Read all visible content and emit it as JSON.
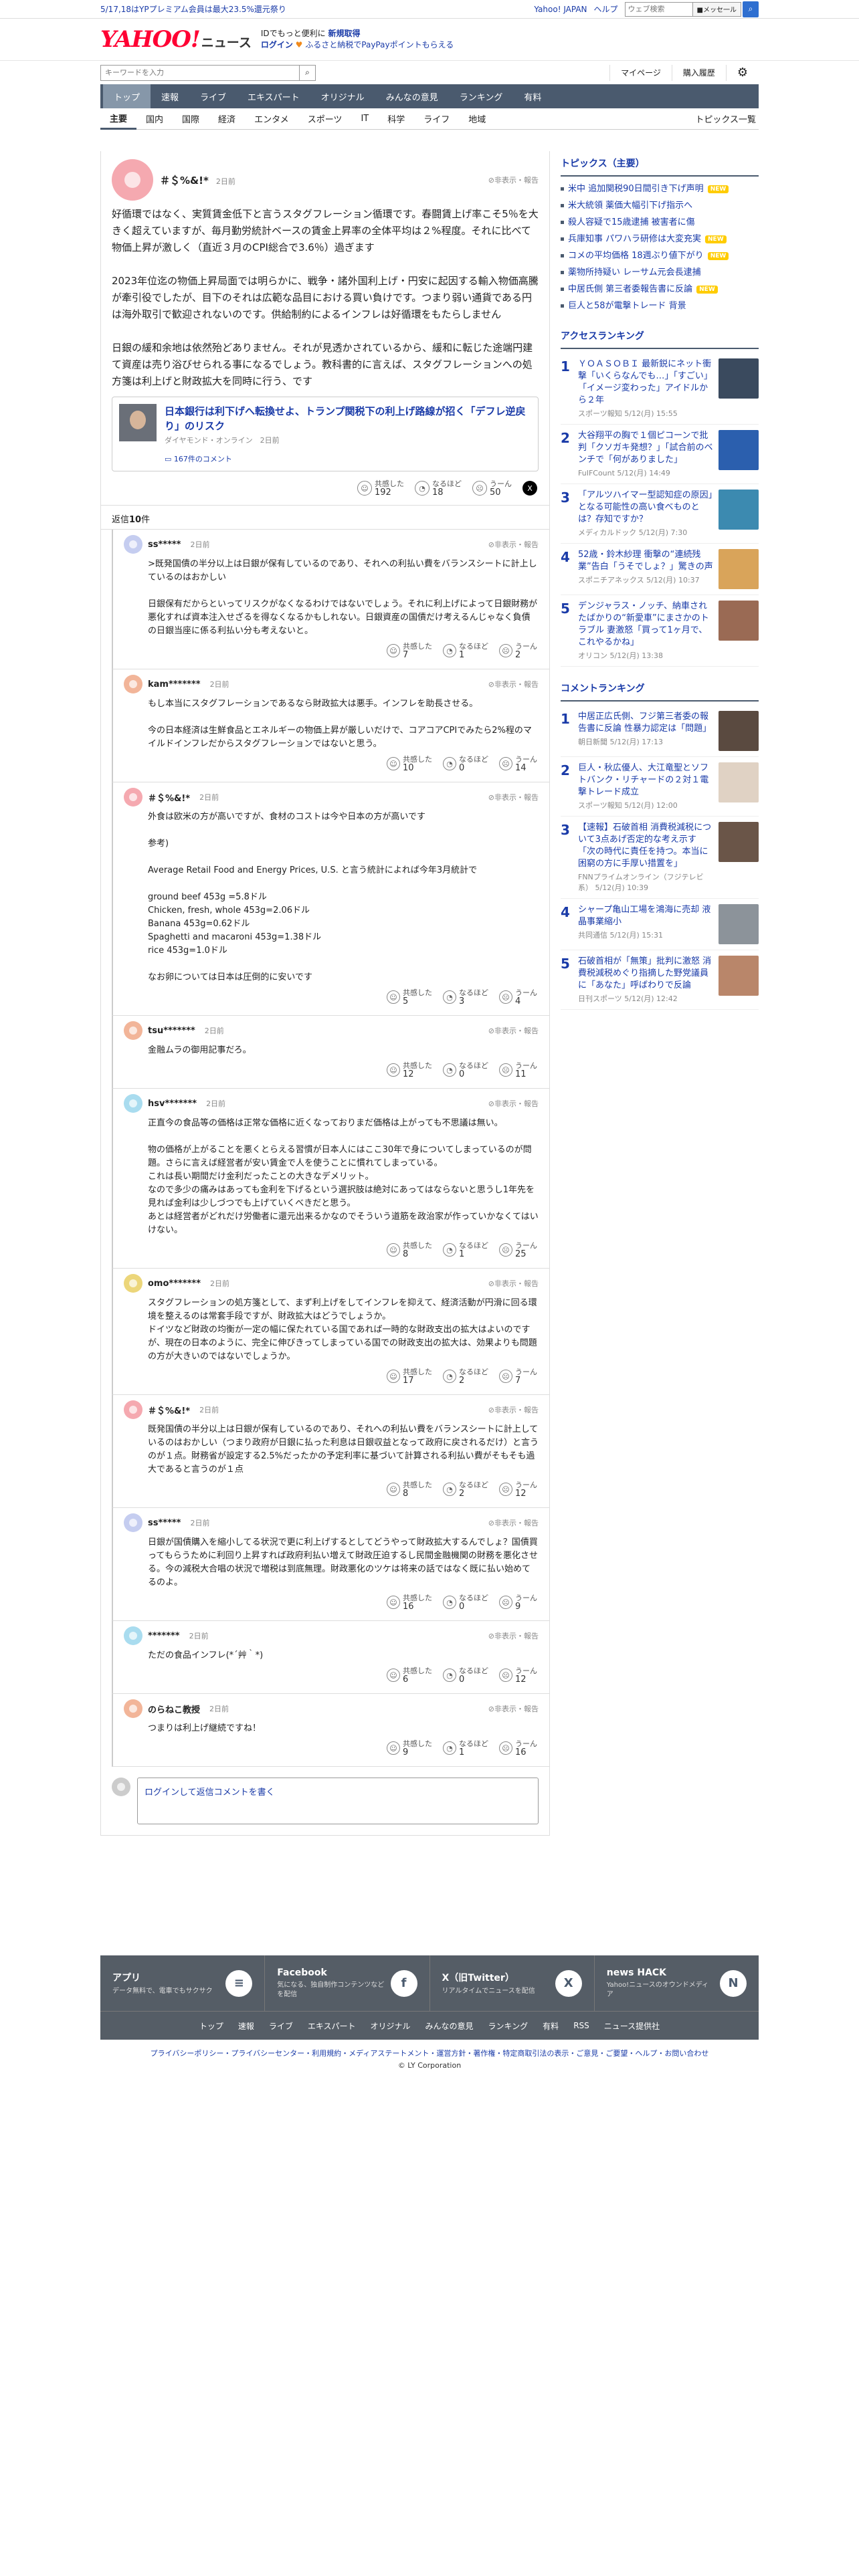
{
  "topstrip": {
    "promo": "5/17,18はYPプレミアム会員は最大23.5%還元祭り",
    "links": [
      "Yahoo! JAPAN",
      "ヘルプ"
    ],
    "search_placeholder": "ウェブ検索",
    "mail_label": "■メッセ一ル"
  },
  "header": {
    "logo_main": "YAHOO!",
    "logo_sub": "JAPAN",
    "logo_news": "ニュース",
    "promo_line1_prefix": "IDでもっと便利に",
    "promo_line1_link": "新規取得",
    "promo_line2_login": "ログイン",
    "promo_line2_text": "ふるさと納税でPayPayポイントもらえる"
  },
  "search": {
    "placeholder": "キーワードを入力",
    "mypage": "マイページ",
    "purchase": "購入履歴"
  },
  "nav": {
    "items": [
      "トップ",
      "速報",
      "ライブ",
      "エキスパート",
      "オリジナル",
      "みんなの意見",
      "ランキング",
      "有料"
    ]
  },
  "subnav": {
    "items": [
      "主要",
      "国内",
      "国際",
      "経済",
      "エンタメ",
      "スポーツ",
      "IT",
      "科学",
      "ライフ",
      "地域"
    ],
    "right": "トピックス一覧"
  },
  "main_comment": {
    "user": "＃＄%&!*",
    "time": "2日前",
    "report": "非表示・報告",
    "paragraphs": [
      "好循環ではなく、実質賃金低下と言うスタグフレーション循環です。春闘賃上げ率こそ5％を大きく超えていますが、毎月勤労統計ベースの賃金上昇率の全体平均は２%程度。それに比べて物価上昇が激しく（直近３月のCPI総合で3.6％）過ぎます",
      "2023年位迄の物価上昇局面では明らかに、戦争・諸外国利上げ・円安に起因する輸入物価高騰が牽引役でしたが、目下のそれは広範な品目における買い負けです。つまり弱い通貨である円は海外取引で歓迎されないのです。供給制約によるインフレは好循環をもたらしません",
      "日銀の緩和余地は依然殆どありません。それが見透かされているから、緩和に転じた途端円建て資産は売り浴びせられる事になるでしょう。教科書的に言えば、スタグフレーションへの処方箋は利上げと財政拡大を同時に行う、です"
    ],
    "article": {
      "title": "日本銀行は利下げへ転換せよ、トランプ関税下の利上げ路線が招く「デフレ逆戻り」のリスク",
      "source": "ダイヤモンド・オンライン",
      "time": "2日前",
      "comments": "167件のコメント"
    },
    "reactions": [
      {
        "label": "共感した",
        "count": "192"
      },
      {
        "label": "なるほど",
        "count": "18"
      },
      {
        "label": "うーん",
        "count": "50"
      }
    ]
  },
  "reply_count": {
    "prefix": "返信",
    "count": "10",
    "suffix": "件"
  },
  "replies": [
    {
      "user": "ss*****",
      "time": "2日前",
      "color": "#c5cdf0",
      "body": ">既発国債の半分以上は日銀が保有しているのであり、それへの利払い費をバランスシートに計上しているのはおかしい\n\n日銀保有だからといってリスクがなくなるわけではないでしょう。それに利上げによって日銀財務が悪化すれば資本注入せざるを得なくなるかもしれない。日銀資産の国債だけ考えるんじゃなく負債の日銀当座に係る利払い分も考えないと。",
      "counts": [
        "7",
        "1",
        "2"
      ]
    },
    {
      "user": "kam*******",
      "time": "2日前",
      "color": "#f2b599",
      "body": "もし本当にスタグフレーションであるなら財政拡大は悪手。インフレを助長させる。\n\n今の日本経済は生鮮食品とエネルギーの物価上昇が厳しいだけで、コアコアCPIでみたら2%程のマイルドインフレだからスタグフレーションではないと思う。",
      "counts": [
        "10",
        "0",
        "14"
      ]
    },
    {
      "user": "＃＄%&!*",
      "time": "2日前",
      "color": "#f5a9b0",
      "body": "外食は欧米の方が高いですが、食材のコストは今や日本の方が高いです\n\n参考)\n\nAverage Retail Food and Energy Prices, U.S. と言う統計によれば今年3月統計で\n\nground beef 453g =5.8ドル\nChicken, fresh, whole 453g=2.06ドル\nBanana 453g=0.62ドル\nSpaghetti and macaroni 453g=1.38ドル\nrice 453g=1.0ドル\n\nなお卵については日本は圧倒的に安いです",
      "counts": [
        "5",
        "3",
        "4"
      ]
    },
    {
      "user": "tsu*******",
      "time": "2日前",
      "color": "#f2b599",
      "body": "金融ムラの御用記事だろ。",
      "counts": [
        "12",
        "0",
        "11"
      ]
    },
    {
      "user": "hsv*******",
      "time": "2日前",
      "color": "#a9dcef",
      "body": "正直今の食品等の価格は正常な価格に近くなっておりまだ価格は上がっても不思議は無い。\n\n物の価格が上がることを悪くとらえる習慣が日本人にはここ30年で身についてしまっているのが問題。さらに言えば経営者が安い賃金で人を使うことに慣れてしまっている。\nこれは長い期間だけ金利だったことの大きなデメリット。\nなので多少の痛みはあっても金利を下げるという選択肢は絶対にあってはならないと思うし1年先を見れば金利は少しづつでも上げていくべきだと思う。\nあとは経営者がどれだけ労働者に還元出来るかなのでそういう道筋を政治家が作っていかなくてはいけない。",
      "counts": [
        "8",
        "1",
        "25"
      ]
    },
    {
      "user": "omo*******",
      "time": "2日前",
      "color": "#ecd67a",
      "body": "スタグフレーションの処方箋として、まず利上げをしてインフレを抑えて、経済活動が円滑に回る環境を整えるのは常套手段ですが、財政拡大はどうでしょうか。\nドイツなど財政の均衡が一定の幅に保たれている国であれば一時的な財政支出の拡大はよいのですが、現在の日本のように、完全に伸びきってしまっている国での財政支出の拡大は、効果よりも問題の方が大きいのではないでしょうか。",
      "counts": [
        "17",
        "2",
        "7"
      ]
    },
    {
      "user": "＃＄%&!*",
      "time": "2日前",
      "color": "#f5a9b0",
      "body": "既発国債の半分以上は日銀が保有しているのであり、それへの利払い費をバランスシートに計上しているのはおかしい（つまり政府が日銀に払った利息は日銀収益となって政府に戻されるだけ）と言うのが１点。財務省が設定する2.5%だったかの予定利率に基づいて計算される利払い費がそもそも過大であると言うのが１点",
      "counts": [
        "8",
        "2",
        "12"
      ]
    },
    {
      "user": "ss*****",
      "time": "2日前",
      "color": "#c5cdf0",
      "body": "日銀が国債購入を縮小してる状況で更に利上げするとしてどうやって財政拡大するんでしょ？国債買ってもらうために利回り上昇すれば政府利払い増えて財政圧迫するし民間金融機関の財務を悪化させる。今の減税大合唱の状況で増税は到底無理。財政悪化のツケは将来の話ではなく既に払い始めてるのよ。",
      "counts": [
        "16",
        "0",
        "9"
      ]
    },
    {
      "user": "*******",
      "time": "2日前",
      "color": "#a9dcef",
      "body": "ただの食品インフレ(*´艸｀*)",
      "counts": [
        "6",
        "0",
        "12"
      ]
    },
    {
      "user": "のらねこ教授",
      "time": "2日前",
      "color": "#f2b599",
      "body": "つまりは利上げ継続ですね！",
      "counts": [
        "9",
        "1",
        "16"
      ]
    }
  ],
  "reaction_labels": [
    "共感した",
    "なるほど",
    "うーん"
  ],
  "reply_input": {
    "placeholder": "ログインして返信コメントを書く"
  },
  "sidebar": {
    "topics_title": "トピックス（主要）",
    "topics": [
      {
        "text": "米中 追加関税90日間引き下げ声明",
        "new": true
      },
      {
        "text": "米大統領 薬価大幅引下げ指示へ",
        "new": false
      },
      {
        "text": "殺人容疑で15歳逮捕 被害者に傷",
        "new": false
      },
      {
        "text": "兵庫知事 パワハラ研修は大変充実",
        "new": true
      },
      {
        "text": "コメの平均価格 18週ぶり値下がり",
        "new": true
      },
      {
        "text": "薬物所持疑い レーサム元会長逮捕",
        "new": false
      },
      {
        "text": "中居氏側 第三者委報告書に反論",
        "new": true
      },
      {
        "text": "巨人と58が電撃トレード 背景",
        "new": false
      }
    ],
    "access_title": "アクセスランキング",
    "access": [
      {
        "num": "1",
        "title": "ＹＯＡＳＯＢＩ 最新鋭にネット衝撃「いくらなんでも…」「すごい」「イメージ変わった」アイドルから２年",
        "source": "スポーツ報知 5/12(月) 15:55",
        "color": "#3a4a5e"
      },
      {
        "num": "2",
        "title": "大谷翔平の胸で１個ピコーンで批判「クソガキ発想？」「試合前のベンチで「何がありました」",
        "source": "FuIFCount 5/12(月) 14:49",
        "color": "#2b5fae"
      },
      {
        "num": "3",
        "title": "「アルツハイマー型認知症の原因」となる可能性の高い食べものとは？存知ですか？",
        "source": "メディカルドック 5/12(月) 7:30",
        "color": "#3c8ab0"
      },
      {
        "num": "4",
        "title": "52歳・鈴木紗理 衝撃の“連続残業”告白「うそでしょ？」驚きの声",
        "source": "スポニチアネックス 5/12(月) 10:37",
        "color": "#d9a45a"
      },
      {
        "num": "5",
        "title": "デンジャラス・ノッチ、納車されたばかりの“新愛車”にまさかのトラブル 妻激怒「買って1ヶ月で、これやるかね」",
        "source": "オリコン 5/12(月) 13:38",
        "color": "#9a6a54"
      }
    ],
    "comment_title": "コメントランキング",
    "comment": [
      {
        "num": "1",
        "title": "中居正広氏側、フジ第三者委の報告書に反論 性暴力認定は「問題」",
        "source": "朝日新聞 5/12(月) 17:13",
        "color": "#5a4a40"
      },
      {
        "num": "2",
        "title": "巨人・秋広優人、大江竜聖とソフトバンク・リチャードの２対１電撃トレード成立",
        "source": "スポーツ報知 5/12(月) 12:00",
        "color": "#e0d2c4"
      },
      {
        "num": "3",
        "title": "【速報】石破首相 消費税減税について3点あげ否定的な考え示す「次の時代に責任を持つ。本当に困窮の方に手厚い措置を」",
        "source": "FNNプライムオンライン（フジテレビ系） 5/12(月) 10:39",
        "color": "#6a5548"
      },
      {
        "num": "4",
        "title": "シャープ亀山工場を鴻海に売却 液晶事業縮小",
        "source": "共同通信 5/12(月) 15:31",
        "color": "#8c939a"
      },
      {
        "num": "5",
        "title": "石破首相が「無策」批判に激怒 消費税減税めぐり指摘した野党議員に「あなた」呼ばわりで反論",
        "source": "日刊スポーツ 5/12(月) 12:42",
        "color": "#b9866a"
      }
    ]
  },
  "footer": {
    "cards": [
      {
        "title": "アプリ",
        "desc": "データ無料で、電車でもサクサク",
        "icon": "≡"
      },
      {
        "title": "Facebook",
        "desc": "気になる、独自制作コンテンツなどを配信",
        "icon": "f"
      },
      {
        "title": "X（旧Twitter）",
        "desc": "リアルタイムでニュースを配信",
        "icon": "X"
      },
      {
        "title": "news HACK",
        "desc": "Yahoo!ニュースのオウンドメディア",
        "icon": "N"
      }
    ],
    "links": [
      "トップ",
      "速報",
      "ライブ",
      "エキスパート",
      "オリジナル",
      "みんなの意見",
      "ランキング",
      "有料",
      "RSS",
      "ニュース提供社"
    ],
    "legal": "プライバシーポリシー・プライバシーセンター・利用規約・メディアステートメント・運営方針・著作権・特定商取引法の表示・ご意見・ご要望・ヘルプ・お問い合わせ",
    "copyright": "© LY Corporation"
  },
  "colors": {
    "nav": "#4a5a6e",
    "link": "#1a3ba8",
    "logo": "#ff0033",
    "new_badge": "#ffcc00"
  }
}
